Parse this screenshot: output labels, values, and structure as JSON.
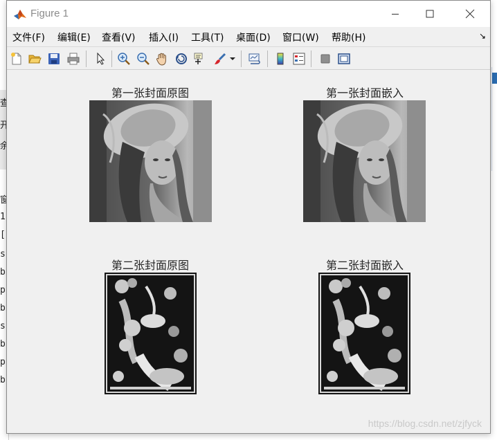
{
  "window": {
    "title": "Figure 1",
    "controls": {
      "minimize": "—",
      "maximize": "☐",
      "close": "✕"
    }
  },
  "menubar": {
    "items": [
      {
        "label": "文件(F)"
      },
      {
        "label": "编辑(E)"
      },
      {
        "label": "查看(V)"
      },
      {
        "label": "插入(I)"
      },
      {
        "label": "工具(T)"
      },
      {
        "label": "桌面(D)"
      },
      {
        "label": "窗口(W)"
      },
      {
        "label": "帮助(H)"
      }
    ],
    "dock_glyph": "↘"
  },
  "toolbar": {
    "buttons": [
      {
        "name": "new-figure-icon"
      },
      {
        "name": "open-file-icon"
      },
      {
        "name": "save-icon"
      },
      {
        "name": "print-icon"
      },
      {
        "name": "select-arrow-icon"
      },
      {
        "name": "zoom-in-icon"
      },
      {
        "name": "zoom-out-icon"
      },
      {
        "name": "pan-hand-icon"
      },
      {
        "name": "rotate-3d-icon"
      },
      {
        "name": "data-cursor-icon"
      },
      {
        "name": "brush-icon"
      },
      {
        "name": "link-plot-icon"
      },
      {
        "name": "insert-colorbar-icon"
      },
      {
        "name": "insert-legend-icon"
      },
      {
        "name": "hide-plot-tools-icon"
      },
      {
        "name": "show-plot-tools-icon"
      }
    ]
  },
  "subplots": [
    {
      "title": "第一张封面原图",
      "image": "portrait-grayscale"
    },
    {
      "title": "第一张封面嵌入",
      "image": "portrait-grayscale"
    },
    {
      "title": "第二张封面原图",
      "image": "engraving-grayscale"
    },
    {
      "title": "第二张封面嵌入",
      "image": "engraving-grayscale"
    }
  ],
  "background": {
    "left_fragments": [
      "查",
      "开",
      "余",
      "窗",
      "1",
      "[",
      "s",
      "b",
      "p",
      "b",
      "s",
      "b",
      "p",
      "b"
    ]
  },
  "watermark": "https://blog.csdn.net/zjfyck"
}
